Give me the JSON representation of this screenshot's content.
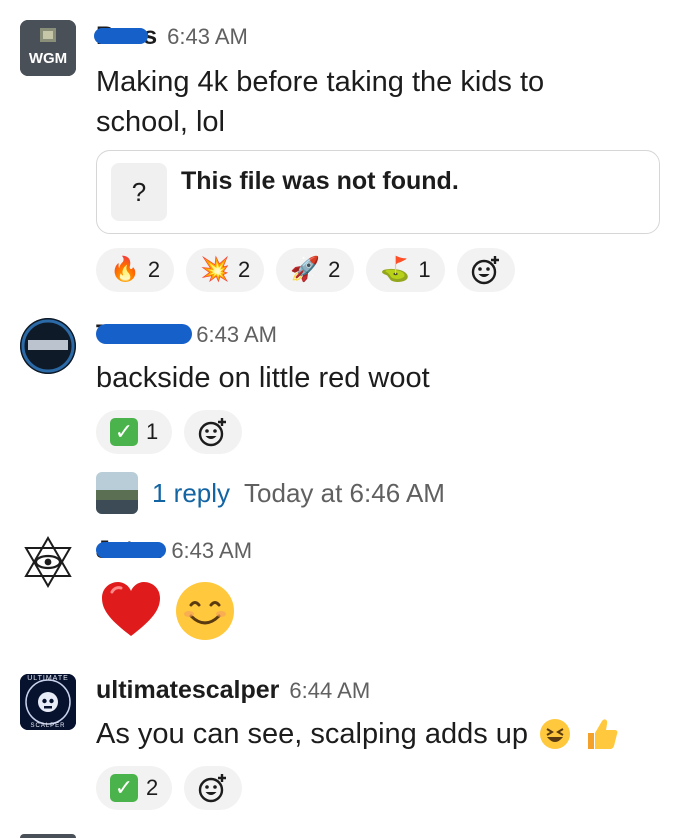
{
  "messages": [
    {
      "author": "Ross",
      "time": "6:43 AM",
      "avatar_text": "WGM",
      "text_line1": "Making 4k before taking the kids to",
      "text_line2": "school, lol",
      "file": {
        "icon": "?",
        "title": "This file was not found."
      },
      "reactions": [
        {
          "emoji": "🔥",
          "count": "2"
        },
        {
          "emoji": "💥",
          "count": "2"
        },
        {
          "emoji": "🚀",
          "count": "2"
        },
        {
          "emoji": "⛳",
          "count": "1"
        }
      ]
    },
    {
      "author": "T D",
      "time": "6:43 AM",
      "text": "backside on little red woot",
      "reactions": [
        {
          "emoji": "✓",
          "count": "1"
        }
      ],
      "thread": {
        "reply": "1 reply",
        "time": "Today at 6:46 AM"
      }
    },
    {
      "author": "Jotea",
      "time": "6:43 AM",
      "emojis": [
        "heart",
        "smiling-face"
      ]
    },
    {
      "author": "ultimatescalper",
      "time": "6:44 AM",
      "avatar_text_top": "ULTIMATE",
      "avatar_text_bottom": "SCALPER",
      "text": "As you can see, scalping adds up",
      "reactions": [
        {
          "emoji": "✓",
          "count": "2"
        }
      ]
    }
  ],
  "colors": {
    "link": "#1264a3",
    "timestamp": "#616061",
    "reaction_bg": "#f2f2f2",
    "redaction": "#1560c9"
  }
}
